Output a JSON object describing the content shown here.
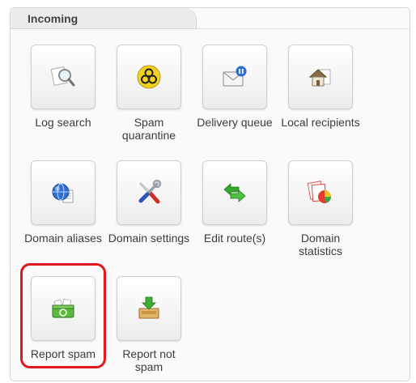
{
  "section": {
    "title": "Incoming"
  },
  "items": [
    {
      "label1": "Log search",
      "label2": ""
    },
    {
      "label1": "Spam",
      "label2": "quarantine"
    },
    {
      "label1": "Delivery queue",
      "label2": ""
    },
    {
      "label1": "Local recipients",
      "label2": ""
    },
    {
      "label1": "Domain aliases",
      "label2": ""
    },
    {
      "label1": "Domain settings",
      "label2": ""
    },
    {
      "label1": "Edit route(s)",
      "label2": ""
    },
    {
      "label1": "Domain",
      "label2": "statistics"
    },
    {
      "label1": "Report spam",
      "label2": ""
    },
    {
      "label1": "Report not",
      "label2": "spam"
    }
  ],
  "icons": {
    "log_search": "magnifier-icon",
    "spam_quarantine": "biohazard-icon",
    "delivery_queue": "mail-pause-icon",
    "local_recipients": "house-icon",
    "domain_aliases": "globe-document-icon",
    "domain_settings": "tools-icon",
    "edit_routes": "arrows-icon",
    "domain_statistics": "pie-chart-icon",
    "report_spam": "recycle-bin-icon",
    "report_not_spam": "tray-download-icon"
  },
  "colors": {
    "highlight": "#e2161b",
    "biohazard_yellow": "#f2d21f",
    "arrow_green": "#35a82d",
    "globe_blue": "#2f6fd0"
  }
}
